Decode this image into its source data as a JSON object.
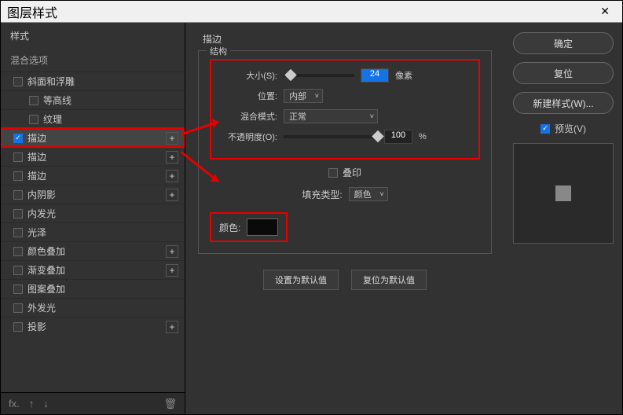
{
  "window": {
    "title": "图层样式"
  },
  "sidebar": {
    "header": "样式",
    "blend_options": "混合选项",
    "items": [
      {
        "label": "斜面和浮雕",
        "checked": false,
        "plus": false,
        "indent": false
      },
      {
        "label": "等高线",
        "checked": false,
        "plus": false,
        "indent": true
      },
      {
        "label": "纹理",
        "checked": false,
        "plus": false,
        "indent": true
      },
      {
        "label": "描边",
        "checked": true,
        "plus": true,
        "indent": false,
        "highlight": true
      },
      {
        "label": "描边",
        "checked": false,
        "plus": true,
        "indent": false
      },
      {
        "label": "描边",
        "checked": false,
        "plus": true,
        "indent": false
      },
      {
        "label": "内阴影",
        "checked": false,
        "plus": true,
        "indent": false
      },
      {
        "label": "内发光",
        "checked": false,
        "plus": false,
        "indent": false
      },
      {
        "label": "光泽",
        "checked": false,
        "plus": false,
        "indent": false
      },
      {
        "label": "颜色叠加",
        "checked": false,
        "plus": true,
        "indent": false
      },
      {
        "label": "渐变叠加",
        "checked": false,
        "plus": true,
        "indent": false
      },
      {
        "label": "图案叠加",
        "checked": false,
        "plus": false,
        "indent": false
      },
      {
        "label": "外发光",
        "checked": false,
        "plus": false,
        "indent": false
      },
      {
        "label": "投影",
        "checked": false,
        "plus": true,
        "indent": false
      }
    ]
  },
  "main": {
    "section_title": "描边",
    "structure_title": "结构",
    "size_label": "大小(S):",
    "size_value": "24",
    "size_unit": "像素",
    "position_label": "位置:",
    "position_value": "内部",
    "blend_mode_label": "混合模式:",
    "blend_mode_value": "正常",
    "opacity_label": "不透明度(O):",
    "opacity_value": "100",
    "opacity_unit": "%",
    "overprint_label": "叠印",
    "fill_type_label": "填充类型:",
    "fill_type_value": "颜色",
    "color_label": "颜色:",
    "color_value": "#0a0a0a",
    "set_default_label": "设置为默认值",
    "reset_default_label": "复位为默认值"
  },
  "right": {
    "ok": "确定",
    "cancel": "复位",
    "new_style": "新建样式(W)...",
    "preview_label": "预览(V)"
  }
}
